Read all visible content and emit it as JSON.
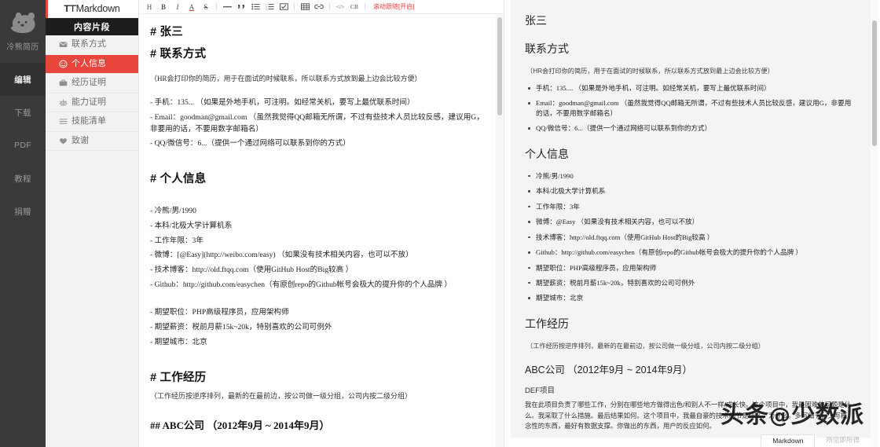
{
  "rail": {
    "brand_label": "冷熊简历",
    "brand_icon": "bear-logo-icon",
    "items": [
      {
        "label": "编辑",
        "active": true
      },
      {
        "label": "下载",
        "active": false
      },
      {
        "label": "PDF",
        "active": false
      },
      {
        "label": "教程",
        "active": false
      },
      {
        "label": "捐赠",
        "active": false
      }
    ]
  },
  "snippets": {
    "logo_prefix": "T⊤",
    "logo_text": "Markdown",
    "header": "内容片段",
    "items": [
      {
        "label": "联系方式",
        "icon": "envelope-icon",
        "active": false
      },
      {
        "label": "个人信息",
        "icon": "smiley-face-icon",
        "active": true
      },
      {
        "label": "经历证明",
        "icon": "briefcase-icon",
        "active": false
      },
      {
        "label": "能力证明",
        "icon": "balance-scale-icon",
        "active": false
      },
      {
        "label": "技能清单",
        "icon": "list-icon",
        "active": false
      },
      {
        "label": "致谢",
        "icon": "heart-hands-icon",
        "active": false
      }
    ]
  },
  "toolbar": {
    "buttons": [
      {
        "label": "H",
        "name": "heading-button"
      },
      {
        "label": "B",
        "name": "bold-button"
      },
      {
        "label": "I",
        "name": "italic-button"
      },
      {
        "label": "A",
        "name": "text-color-button"
      },
      {
        "label": "S",
        "name": "strikethrough-button"
      },
      {
        "label": "—",
        "name": "horizontal-rule-button"
      },
      {
        "label": "“",
        "name": "blockquote-button"
      },
      {
        "label": "≔",
        "name": "bullet-list-button"
      },
      {
        "label": "≕",
        "name": "ordered-list-button"
      },
      {
        "label": "☑",
        "name": "task-list-button"
      },
      {
        "label": "▦",
        "name": "table-button"
      },
      {
        "label": "∞",
        "name": "link-button"
      },
      {
        "label": "</>",
        "name": "code-button"
      },
      {
        "label": "CB",
        "name": "code-block-button"
      }
    ],
    "scroll_sync_label": "滚动跟随[开启]"
  },
  "editor": {
    "blocks": [
      {
        "type": "h1",
        "text": "# 张三"
      },
      {
        "type": "h1",
        "text": "# 联系方式"
      },
      {
        "type": "note",
        "text": "（HR会打印你的简历，用于在面试的时候联系，所以联系方式放到最上边会比较方便）"
      },
      {
        "type": "line",
        "text": "- 手机：135... （如果是外地手机，可注明。如经常关机，要写上最优联系时间）"
      },
      {
        "type": "line",
        "text": "- Email：goodman@gmail.com （虽然我觉得QQ邮箱无所谓，不过有些技术人员比较反感，建议用G，非要用的话，不要用数字邮箱名）"
      },
      {
        "type": "line",
        "text": "- QQ/微信号：6...（提供一个通过网络可以联系到你的方式）"
      },
      {
        "type": "gap"
      },
      {
        "type": "h1",
        "text": "# 个人信息"
      },
      {
        "type": "gap-s"
      },
      {
        "type": "line",
        "text": "- 冷熊/男/1990"
      },
      {
        "type": "line",
        "text": "- 本科/北极大学计算机系"
      },
      {
        "type": "line",
        "text": "- 工作年限：3年"
      },
      {
        "type": "line",
        "text": "- 微博：[@Easy](http://weibo.com/easy) （如果没有技术相关内容，也可以不放）"
      },
      {
        "type": "line",
        "text": "- 技术博客：http://old.ftqq.com（使用GitHub Host的Big较高 ）"
      },
      {
        "type": "line",
        "text": "- Github：http://github.com/easychen（有原创repo的Github帐号会极大的提升你的个人品牌 ）"
      },
      {
        "type": "gap-s"
      },
      {
        "type": "line",
        "text": "- 期望职位：PHP高级程序员，应用架构师"
      },
      {
        "type": "line",
        "text": "- 期望薪资：税前月薪15k~20k，特别喜欢的公司可例外"
      },
      {
        "type": "line",
        "text": "- 期望城市：北京"
      },
      {
        "type": "gap"
      },
      {
        "type": "h1",
        "text": "# 工作经历"
      },
      {
        "type": "note",
        "text": "（工作经历按逆序排列，最新的在最前边，按公司做一级分组，公司内按二级分组）"
      },
      {
        "type": "h2",
        "text": "## ABC公司 （2012年9月 ~ 2014年9月）"
      }
    ]
  },
  "preview": {
    "h1_name": "张三",
    "s1_title": "联系方式",
    "s1_note": "（HR会打印你的简历，用于在面试的时候联系，所以联系方式放到最上边会比较方便）",
    "s1_items": [
      "手机：135.... （如果是外地手机，可注明。如经常关机，要写上最优联系时间）",
      "Email：goodman@gmail.com （虽然我觉得QQ邮箱无所谓，不过有些技术人员比较反感，建议用G，非要用的话，不要用数字邮箱名）",
      "QQ/微信号：6...（提供一个通过网络可以联系到你的方式）"
    ],
    "s2_title": "个人信息",
    "s2_items": [
      "冷熊/男/1990",
      "本科/北极大学计算机系",
      "工作年限：3年",
      "微博：@Easy （如果没有技术相关内容，也可以不放）",
      "技术博客：http://old.ftqq.com（使用GitHub Host的Big较高 ）",
      "Github：http://github.com/easychen（有原创repo的Github帐号会极大的提升你的个人品牌 ）",
      "期望职位：PHP高级程序员，应用架构师",
      "期望薪资：税前月薪15k~20k，特别喜欢的公司可例外",
      "期望城市：北京"
    ],
    "s3_title": "工作经历",
    "s3_note": "（工作经历按逆序排列，最新的在最前边，按公司做一级分组，公司内按二级分组）",
    "s3_company": "ABC公司 （2012年9月 ~ 2014年9月）",
    "s3_project": "DEF项目",
    "s3_para": "我在此项目负责了哪些工作，分别在哪些地方做得出色/和别人不一样/成长快。这个项目中，我最困难的问题是什么。我采取了什么措施。最后结果如何。这个项目中，我最自豪的技术细节是什么，为什么。多写细节，少写概念性的东西，最好有数据支撑。你做出的东西，用户的反应如何。"
  },
  "bottom_tabs": [
    {
      "label": "Markdown",
      "active": true
    },
    {
      "label": "所见即所得",
      "active": false
    }
  ],
  "watermark": {
    "left": "头条",
    "at": "@",
    "right": "少数派"
  },
  "colors": {
    "accent": "#e8453c",
    "rail_bg": "#3a3a3a",
    "snippet_bg": "#f2f2f2",
    "preview_bg": "#f4f4f4"
  }
}
